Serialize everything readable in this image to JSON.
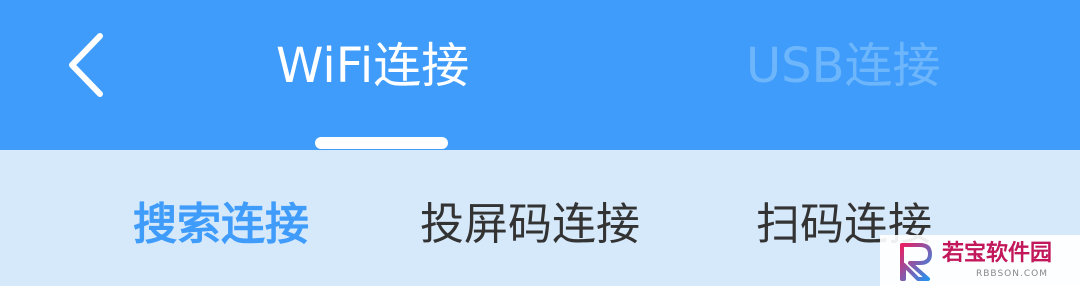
{
  "header": {
    "tabs": [
      {
        "label": "WiFi连接",
        "active": true
      },
      {
        "label": "USB连接",
        "active": false
      }
    ],
    "back_icon": "chevron-left-icon"
  },
  "subtabs": [
    {
      "label": "搜索连接",
      "active": true
    },
    {
      "label": "投屏码连接",
      "active": false
    },
    {
      "label": "扫码连接",
      "active": false
    }
  ],
  "watermark": {
    "text": "若宝软件园",
    "subtext": "RBBSON.COM"
  },
  "colors": {
    "primary": "#3f9cfb",
    "subbar_bg": "#d6e9fb",
    "inactive_tab": "#6eb6fb",
    "text_dark": "#333333"
  }
}
